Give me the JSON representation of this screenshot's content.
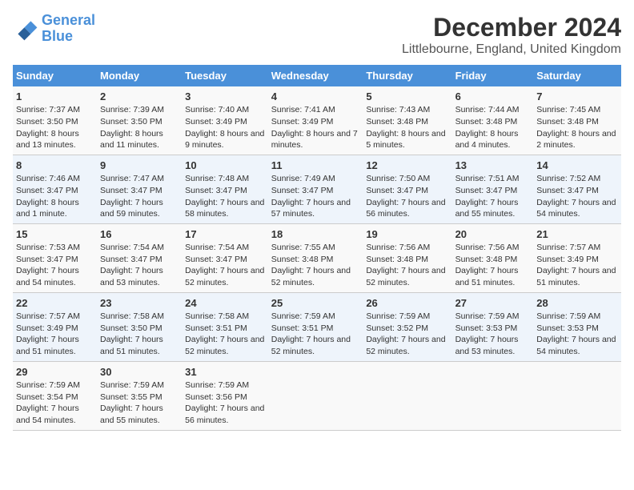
{
  "logo": {
    "line1": "General",
    "line2": "Blue"
  },
  "title": "December 2024",
  "subtitle": "Littlebourne, England, United Kingdom",
  "days": [
    "Sunday",
    "Monday",
    "Tuesday",
    "Wednesday",
    "Thursday",
    "Friday",
    "Saturday"
  ],
  "weeks": [
    [
      {
        "date": "1",
        "sunrise": "Sunrise: 7:37 AM",
        "sunset": "Sunset: 3:50 PM",
        "daylight": "Daylight: 8 hours and 13 minutes."
      },
      {
        "date": "2",
        "sunrise": "Sunrise: 7:39 AM",
        "sunset": "Sunset: 3:50 PM",
        "daylight": "Daylight: 8 hours and 11 minutes."
      },
      {
        "date": "3",
        "sunrise": "Sunrise: 7:40 AM",
        "sunset": "Sunset: 3:49 PM",
        "daylight": "Daylight: 8 hours and 9 minutes."
      },
      {
        "date": "4",
        "sunrise": "Sunrise: 7:41 AM",
        "sunset": "Sunset: 3:49 PM",
        "daylight": "Daylight: 8 hours and 7 minutes."
      },
      {
        "date": "5",
        "sunrise": "Sunrise: 7:43 AM",
        "sunset": "Sunset: 3:48 PM",
        "daylight": "Daylight: 8 hours and 5 minutes."
      },
      {
        "date": "6",
        "sunrise": "Sunrise: 7:44 AM",
        "sunset": "Sunset: 3:48 PM",
        "daylight": "Daylight: 8 hours and 4 minutes."
      },
      {
        "date": "7",
        "sunrise": "Sunrise: 7:45 AM",
        "sunset": "Sunset: 3:48 PM",
        "daylight": "Daylight: 8 hours and 2 minutes."
      }
    ],
    [
      {
        "date": "8",
        "sunrise": "Sunrise: 7:46 AM",
        "sunset": "Sunset: 3:47 PM",
        "daylight": "Daylight: 8 hours and 1 minute."
      },
      {
        "date": "9",
        "sunrise": "Sunrise: 7:47 AM",
        "sunset": "Sunset: 3:47 PM",
        "daylight": "Daylight: 7 hours and 59 minutes."
      },
      {
        "date": "10",
        "sunrise": "Sunrise: 7:48 AM",
        "sunset": "Sunset: 3:47 PM",
        "daylight": "Daylight: 7 hours and 58 minutes."
      },
      {
        "date": "11",
        "sunrise": "Sunrise: 7:49 AM",
        "sunset": "Sunset: 3:47 PM",
        "daylight": "Daylight: 7 hours and 57 minutes."
      },
      {
        "date": "12",
        "sunrise": "Sunrise: 7:50 AM",
        "sunset": "Sunset: 3:47 PM",
        "daylight": "Daylight: 7 hours and 56 minutes."
      },
      {
        "date": "13",
        "sunrise": "Sunrise: 7:51 AM",
        "sunset": "Sunset: 3:47 PM",
        "daylight": "Daylight: 7 hours and 55 minutes."
      },
      {
        "date": "14",
        "sunrise": "Sunrise: 7:52 AM",
        "sunset": "Sunset: 3:47 PM",
        "daylight": "Daylight: 7 hours and 54 minutes."
      }
    ],
    [
      {
        "date": "15",
        "sunrise": "Sunrise: 7:53 AM",
        "sunset": "Sunset: 3:47 PM",
        "daylight": "Daylight: 7 hours and 54 minutes."
      },
      {
        "date": "16",
        "sunrise": "Sunrise: 7:54 AM",
        "sunset": "Sunset: 3:47 PM",
        "daylight": "Daylight: 7 hours and 53 minutes."
      },
      {
        "date": "17",
        "sunrise": "Sunrise: 7:54 AM",
        "sunset": "Sunset: 3:47 PM",
        "daylight": "Daylight: 7 hours and 52 minutes."
      },
      {
        "date": "18",
        "sunrise": "Sunrise: 7:55 AM",
        "sunset": "Sunset: 3:48 PM",
        "daylight": "Daylight: 7 hours and 52 minutes."
      },
      {
        "date": "19",
        "sunrise": "Sunrise: 7:56 AM",
        "sunset": "Sunset: 3:48 PM",
        "daylight": "Daylight: 7 hours and 52 minutes."
      },
      {
        "date": "20",
        "sunrise": "Sunrise: 7:56 AM",
        "sunset": "Sunset: 3:48 PM",
        "daylight": "Daylight: 7 hours and 51 minutes."
      },
      {
        "date": "21",
        "sunrise": "Sunrise: 7:57 AM",
        "sunset": "Sunset: 3:49 PM",
        "daylight": "Daylight: 7 hours and 51 minutes."
      }
    ],
    [
      {
        "date": "22",
        "sunrise": "Sunrise: 7:57 AM",
        "sunset": "Sunset: 3:49 PM",
        "daylight": "Daylight: 7 hours and 51 minutes."
      },
      {
        "date": "23",
        "sunrise": "Sunrise: 7:58 AM",
        "sunset": "Sunset: 3:50 PM",
        "daylight": "Daylight: 7 hours and 51 minutes."
      },
      {
        "date": "24",
        "sunrise": "Sunrise: 7:58 AM",
        "sunset": "Sunset: 3:51 PM",
        "daylight": "Daylight: 7 hours and 52 minutes."
      },
      {
        "date": "25",
        "sunrise": "Sunrise: 7:59 AM",
        "sunset": "Sunset: 3:51 PM",
        "daylight": "Daylight: 7 hours and 52 minutes."
      },
      {
        "date": "26",
        "sunrise": "Sunrise: 7:59 AM",
        "sunset": "Sunset: 3:52 PM",
        "daylight": "Daylight: 7 hours and 52 minutes."
      },
      {
        "date": "27",
        "sunrise": "Sunrise: 7:59 AM",
        "sunset": "Sunset: 3:53 PM",
        "daylight": "Daylight: 7 hours and 53 minutes."
      },
      {
        "date": "28",
        "sunrise": "Sunrise: 7:59 AM",
        "sunset": "Sunset: 3:53 PM",
        "daylight": "Daylight: 7 hours and 54 minutes."
      }
    ],
    [
      {
        "date": "29",
        "sunrise": "Sunrise: 7:59 AM",
        "sunset": "Sunset: 3:54 PM",
        "daylight": "Daylight: 7 hours and 54 minutes."
      },
      {
        "date": "30",
        "sunrise": "Sunrise: 7:59 AM",
        "sunset": "Sunset: 3:55 PM",
        "daylight": "Daylight: 7 hours and 55 minutes."
      },
      {
        "date": "31",
        "sunrise": "Sunrise: 7:59 AM",
        "sunset": "Sunset: 3:56 PM",
        "daylight": "Daylight: 7 hours and 56 minutes."
      },
      null,
      null,
      null,
      null
    ]
  ]
}
